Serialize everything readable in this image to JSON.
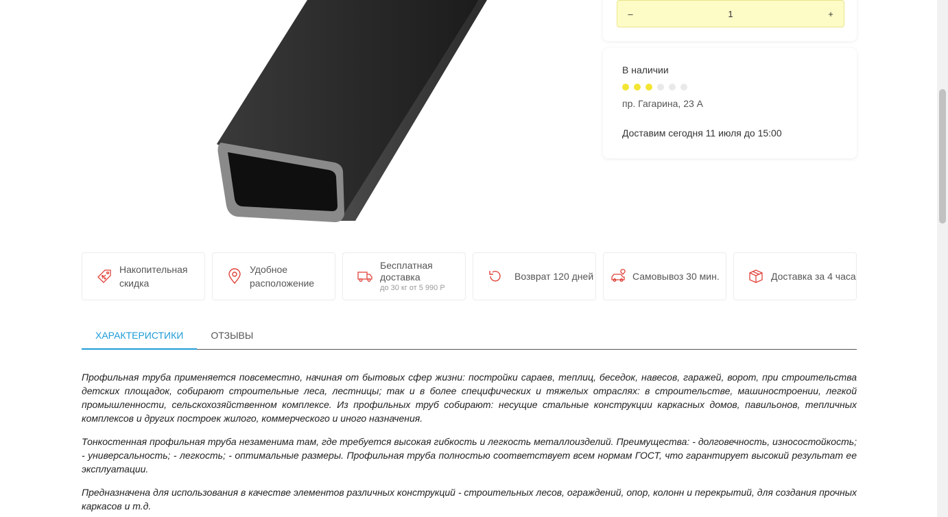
{
  "quantity": {
    "minus": "–",
    "value": "1",
    "plus": "+"
  },
  "stock": {
    "title": "В наличии",
    "level": {
      "filled": 3,
      "total": 6
    },
    "address": "пр. Гагарина, 23 А",
    "delivery": "Доставим сегодня 11 июля до 15:00"
  },
  "advantages": [
    {
      "icon": "discount-tag-icon",
      "label": "Накопительная скидка"
    },
    {
      "icon": "location-pin-icon",
      "label": "Удобное расположение"
    },
    {
      "icon": "delivery-truck-icon",
      "label": "Бесплатная доставка",
      "sub": "до 30 кг от 5 990 Р"
    },
    {
      "icon": "return-arrow-icon",
      "label": "Возврат 120 дней"
    },
    {
      "icon": "car-pickup-icon",
      "label": "Самовывоз 30 мин."
    },
    {
      "icon": "package-box-icon",
      "label": "Доставка за 4 часа"
    }
  ],
  "tabs": [
    {
      "label": "ХАРАКТЕРИСТИКИ",
      "active": true
    },
    {
      "label": "ОТЗЫВЫ",
      "active": false
    }
  ],
  "description": [
    "Профильная труба применяется повсеместно, начиная от бытовых сфер жизни: постройки сараев, теплиц, беседок, навесов, гаражей, ворот, при строительства детских площадок, собирают строительные леса, лестницы; так и в более специфических и тяжелых отраслях: в строительстве, машиностроении, легкой промышленности, сельскохозяйственном комплексе. Из профильных труб собирают: несущие стальные конструкции каркасных домов, павильонов, тепличных комплексов и других построек жилого, коммерческого и иного назначения.",
    "Тонкостенная профильная труба незаменима там, где требуется высокая гибкость и легкость металлоизделий. Преимущества: - долговечность, износостойкость; - универсальность; - легкость; - оптимальные размеры. Профильная труба полностью соответствует всем нормам ГОСТ, что гарантирует высокий результат ее эксплуатации.",
    "Предназначена для использования в качестве элементов различных конструкций - строительных лесов, ограждений, опор, колонн и перекрытий, для создания прочных каркасов и т.д."
  ],
  "colors": {
    "accent": "#1e9bd7",
    "icon_red": "#e0423a",
    "qty_bg": "#fdfbc6",
    "dot_on": "#f2e533"
  }
}
